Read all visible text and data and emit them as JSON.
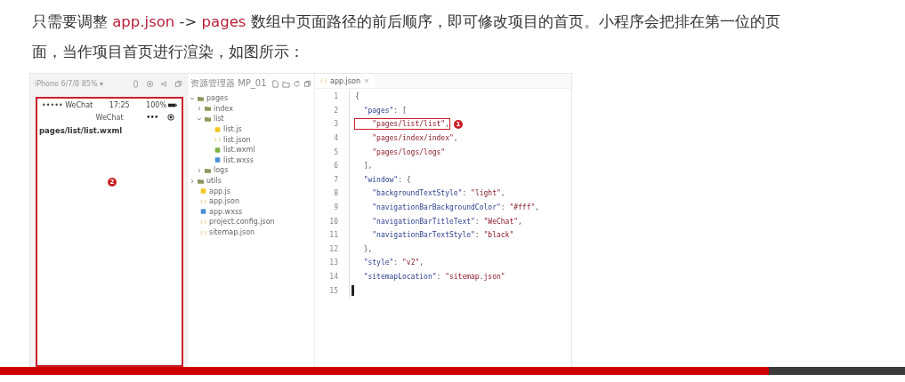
{
  "intro": [
    {
      "text": "只需要调整 ",
      "kind": "plain"
    },
    {
      "text": "app.json",
      "kind": "highlight"
    },
    {
      "text": " -> ",
      "kind": "plain"
    },
    {
      "text": "pages",
      "kind": "highlight"
    },
    {
      "text": " 数组中页面路径的前后顺序，即可修改项目的首页。小程序会把排在第一位的页面，当作项目首页进行渲染，如图所示：",
      "kind": "plain"
    }
  ],
  "simulator": {
    "device": "iPhone 6/7/8 85% ▾",
    "status_left": "••••• WeChat",
    "time": "17:25",
    "battery": "100%",
    "nav_title": "WeChat",
    "nav_dots": "•••",
    "page_text": "pages/list/list.wxml",
    "marker": "2"
  },
  "explorer": {
    "title": "资源管理器 MP_01",
    "tree": [
      {
        "name": "pages",
        "kind": "folder",
        "expanded": true,
        "children": [
          {
            "name": "index",
            "kind": "folder",
            "expanded": false
          },
          {
            "name": "list",
            "kind": "folder",
            "expanded": true,
            "children": [
              {
                "name": "list.js",
                "kind": "js"
              },
              {
                "name": "list.json",
                "kind": "json"
              },
              {
                "name": "list.wxml",
                "kind": "wxml"
              },
              {
                "name": "list.wxss",
                "kind": "wxss"
              }
            ]
          },
          {
            "name": "logs",
            "kind": "folder",
            "expanded": false
          }
        ]
      },
      {
        "name": "utils",
        "kind": "folder",
        "expanded": false
      },
      {
        "name": "app.js",
        "kind": "js"
      },
      {
        "name": "app.json",
        "kind": "json"
      },
      {
        "name": "app.wxss",
        "kind": "wxss"
      },
      {
        "name": "project.config.json",
        "kind": "json"
      },
      {
        "name": "sitemap.json",
        "kind": "json"
      }
    ]
  },
  "editor": {
    "tab": "app.json",
    "tab_close": "×",
    "lines": [
      {
        "number": "1",
        "tokens": [
          {
            "t": "{",
            "kind": "punct"
          }
        ]
      },
      {
        "number": "2",
        "tokens": [
          {
            "t": "  \"pages\"",
            "kind": "key"
          },
          {
            "t": ": [",
            "kind": "punct"
          }
        ]
      },
      {
        "number": "3",
        "boxed": true,
        "marker": "1",
        "tokens": [
          {
            "t": "    \"pages/list/list\"",
            "kind": "string"
          },
          {
            "t": ",",
            "kind": "punct"
          }
        ]
      },
      {
        "number": "4",
        "tokens": [
          {
            "t": "    \"pages/index/index\"",
            "kind": "string"
          },
          {
            "t": ",",
            "kind": "punct"
          }
        ]
      },
      {
        "number": "5",
        "tokens": [
          {
            "t": "    \"pages/logs/logs\"",
            "kind": "string"
          }
        ]
      },
      {
        "number": "6",
        "tokens": [
          {
            "t": "  ],",
            "kind": "punct"
          }
        ]
      },
      {
        "number": "7",
        "tokens": [
          {
            "t": "  \"window\"",
            "kind": "key"
          },
          {
            "t": ": {",
            "kind": "punct"
          }
        ]
      },
      {
        "number": "8",
        "tokens": [
          {
            "t": "    \"backgroundTextStyle\"",
            "kind": "key"
          },
          {
            "t": ": ",
            "kind": "punct"
          },
          {
            "t": "\"light\"",
            "kind": "string"
          },
          {
            "t": ",",
            "kind": "punct"
          }
        ]
      },
      {
        "number": "9",
        "tokens": [
          {
            "t": "    \"navigationBarBackgroundColor\"",
            "kind": "key"
          },
          {
            "t": ": ",
            "kind": "punct"
          },
          {
            "t": "\"#fff\"",
            "kind": "string"
          },
          {
            "t": ",",
            "kind": "punct"
          }
        ]
      },
      {
        "number": "10",
        "tokens": [
          {
            "t": "    \"navigationBarTitleText\"",
            "kind": "key"
          },
          {
            "t": ": ",
            "kind": "punct"
          },
          {
            "t": "\"WeChat\"",
            "kind": "string"
          },
          {
            "t": ",",
            "kind": "punct"
          }
        ]
      },
      {
        "number": "11",
        "tokens": [
          {
            "t": "    \"navigationBarTextStyle\"",
            "kind": "key"
          },
          {
            "t": ": ",
            "kind": "punct"
          },
          {
            "t": "\"black\"",
            "kind": "string"
          }
        ]
      },
      {
        "number": "12",
        "tokens": [
          {
            "t": "  },",
            "kind": "punct"
          }
        ]
      },
      {
        "number": "13",
        "tokens": [
          {
            "t": "  \"style\"",
            "kind": "key"
          },
          {
            "t": ": ",
            "kind": "punct"
          },
          {
            "t": "\"v2\"",
            "kind": "string"
          },
          {
            "t": ",",
            "kind": "punct"
          }
        ]
      },
      {
        "number": "14",
        "tokens": [
          {
            "t": "  \"sitemapLocation\"",
            "kind": "key"
          },
          {
            "t": ": ",
            "kind": "punct"
          },
          {
            "t": "\"sitemap.json\"",
            "kind": "string"
          }
        ]
      },
      {
        "number": "15",
        "cursor": true
      }
    ]
  },
  "player": {
    "level": 0.85
  }
}
